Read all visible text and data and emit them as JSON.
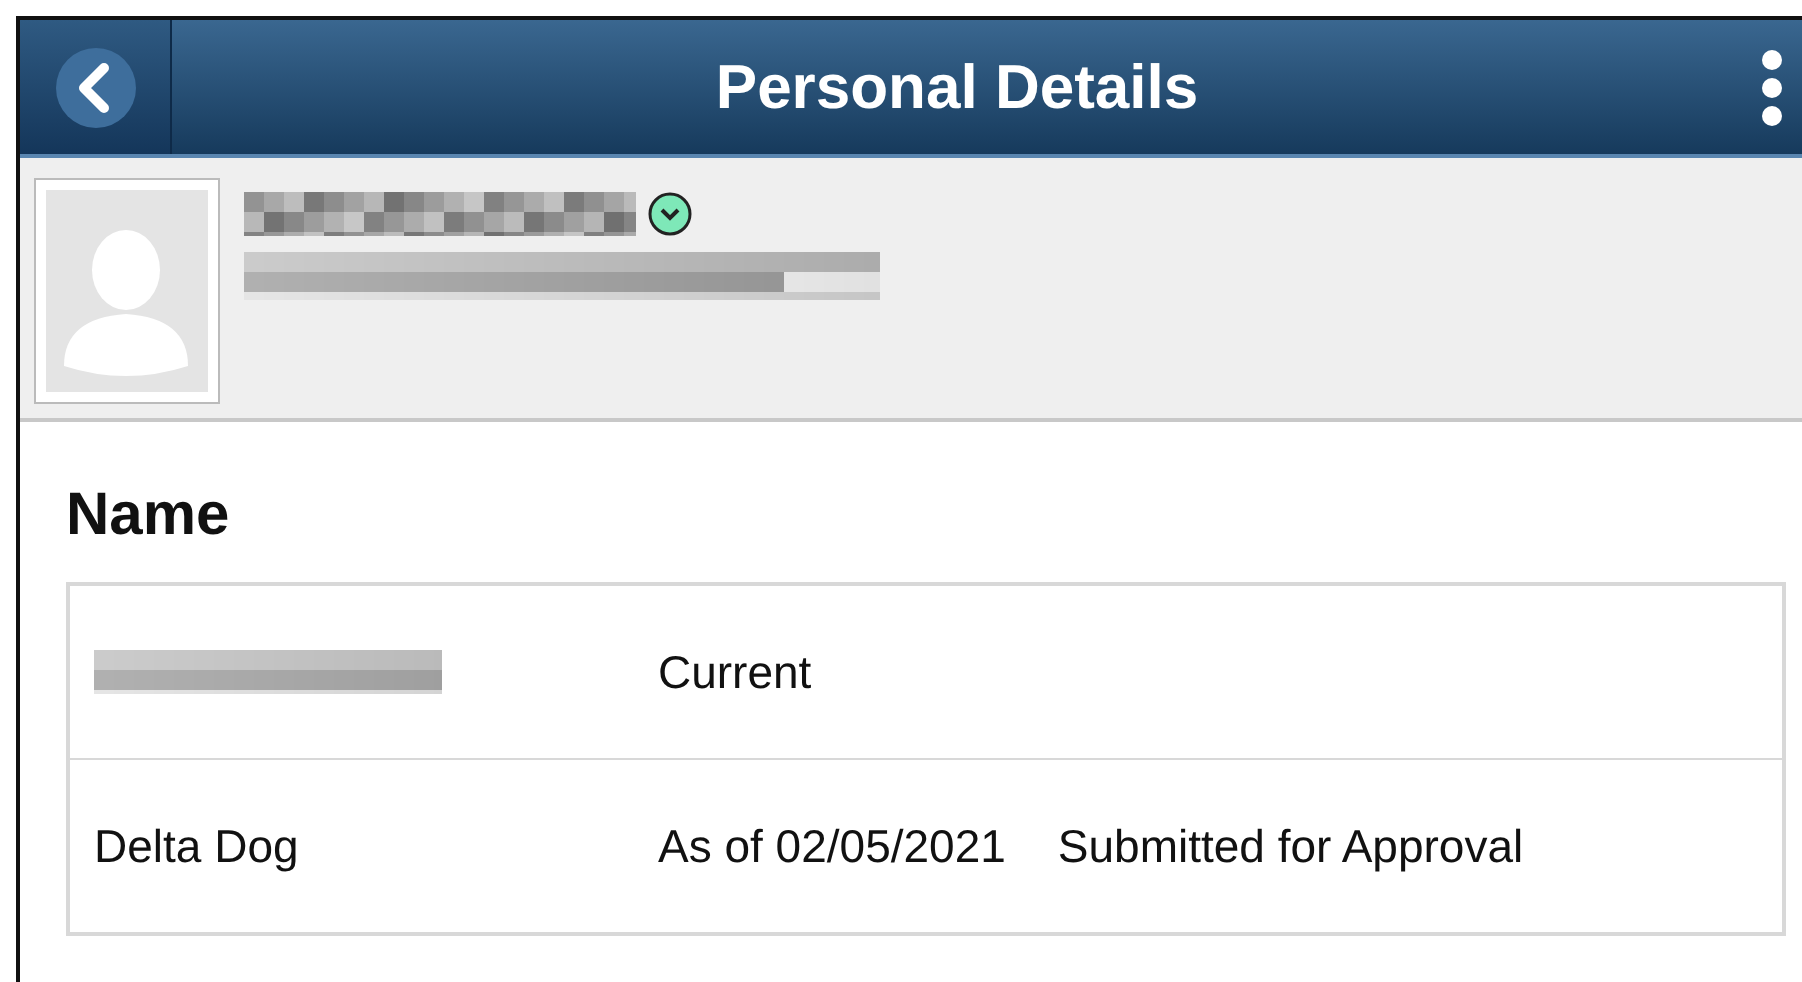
{
  "header": {
    "title": "Personal Details"
  },
  "profile": {
    "name_redacted": true,
    "detail_redacted": true,
    "expanded": false
  },
  "section": {
    "title": "Name",
    "rows": [
      {
        "name_redacted": true,
        "status": "Current"
      },
      {
        "name": "Delta Dog",
        "status": "As of 02/05/2021",
        "note": "Submitted for Approval"
      }
    ]
  }
}
